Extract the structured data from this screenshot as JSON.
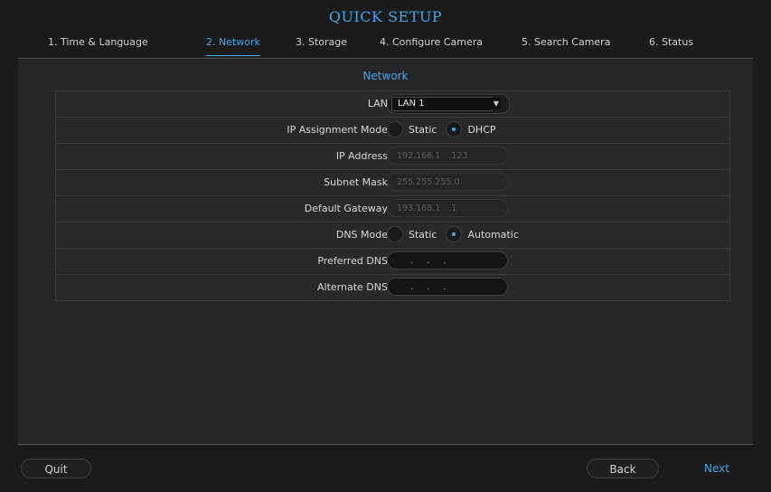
{
  "window": {
    "title": "QUICK SETUP"
  },
  "steps": [
    {
      "label": "1. Time & Language"
    },
    {
      "label": "2. Network"
    },
    {
      "label": "3. Storage"
    },
    {
      "label": "4. Configure Camera"
    },
    {
      "label": "5. Search Camera"
    },
    {
      "label": "6. Status"
    }
  ],
  "active_step": "2. Network",
  "section": {
    "title": "Network"
  },
  "form": {
    "lan": {
      "label": "LAN",
      "value": "LAN 1",
      "arrow": "▼"
    },
    "ip_mode": {
      "label": "IP Assignment Mode",
      "options": [
        "Static",
        "DHCP"
      ],
      "selected": "DHCP"
    },
    "ip_address": {
      "label": "IP Address",
      "value": "192.168.1   .123"
    },
    "subnet_mask": {
      "label": "Subnet Mask",
      "value": "255.255.255.0"
    },
    "default_gateway": {
      "label": "Default Gateway",
      "value": "193.168.1   .1"
    },
    "dns_mode": {
      "label": "DNS Mode",
      "options": [
        "Static",
        "Automatic"
      ],
      "selected": "Automatic"
    },
    "preferred_dns": {
      "label": "Preferred DNS",
      "value": "     .     .     ."
    },
    "alternate_dns": {
      "label": "Alternate DNS",
      "value": "     .     .     ."
    }
  },
  "buttons": {
    "quit": "Quit",
    "back": "Back",
    "next": "Next"
  },
  "colors": {
    "accent": "#4aa3e6",
    "background": "#1b1b1b",
    "panel": "#262626"
  }
}
